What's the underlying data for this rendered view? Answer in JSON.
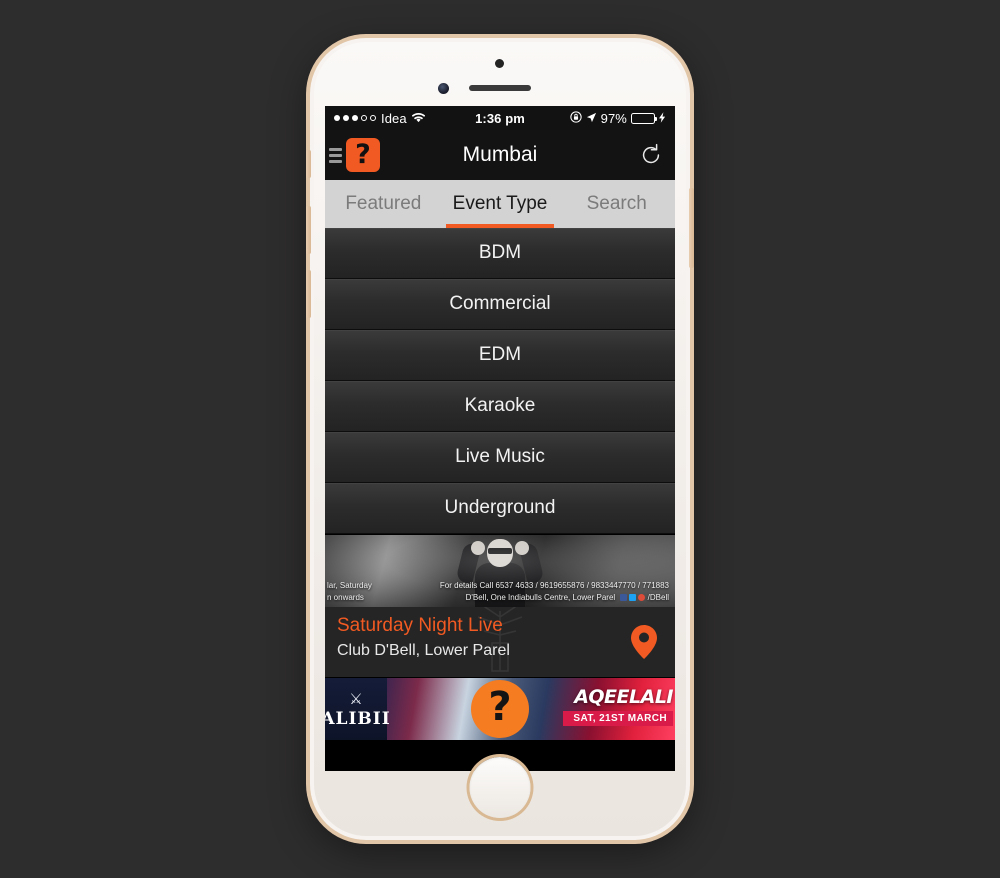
{
  "status_bar": {
    "signal_dots_filled": 3,
    "signal_dots_total": 5,
    "carrier": "Idea",
    "wifi_icon": "wifi-icon",
    "time": "1:36 pm",
    "rotation_lock_icon": "rotation-lock-icon",
    "location_icon": "location-arrow-icon",
    "battery_percent": "97%",
    "battery_fill_percent": 97,
    "battery_color": "#4cd964",
    "charging_icon": "lightning-bolt-icon"
  },
  "nav_bar": {
    "menu_icon": "hamburger-menu-icon",
    "logo_glyph": "?",
    "title": "Mumbai",
    "refresh_icon": "refresh-icon",
    "background": "#131313"
  },
  "tabs": {
    "active_index": 1,
    "accent_color": "#f15a22",
    "items": [
      {
        "label": "Featured"
      },
      {
        "label": "Event Type"
      },
      {
        "label": "Search"
      }
    ]
  },
  "event_types": [
    {
      "label": "BDM"
    },
    {
      "label": "Commercial"
    },
    {
      "label": "EDM"
    },
    {
      "label": "Karaoke"
    },
    {
      "label": "Live Music"
    },
    {
      "label": "Underground"
    }
  ],
  "event_card": {
    "banner": {
      "left_line_1": "lar, Saturday",
      "left_line_2": "n onwards",
      "detail_line_1": "For details Call 6537 4633 / 9619655876 / 9833447770 / 771883",
      "detail_line_2": "D'Bell, One Indiabulls Centre, Lower Parel",
      "social_handle": "/DBell",
      "figure": "dj-silhouette"
    },
    "title": "Saturday Night Live",
    "title_color": "#f15a22",
    "venue": "Club D'Bell, Lower Parel",
    "map_pin_icon": "map-pin-icon",
    "map_pin_color": "#f15a22"
  },
  "promo_banner": {
    "club_name": "ALIBII",
    "crest_icon": "heraldic-crest-icon",
    "logo_glyph": "?",
    "artist": "AQEELALI",
    "date": "SAT, 21ST MARCH",
    "date_badge_color": "#d81b48"
  },
  "device": {
    "home_button": "home-button",
    "front_camera": "front-camera",
    "earpiece": "earpiece-speaker",
    "volume_up_button": "volume-up-button",
    "volume_down_button": "volume-down-button",
    "power_button": "power-button",
    "silent_switch": "silent-switch"
  }
}
